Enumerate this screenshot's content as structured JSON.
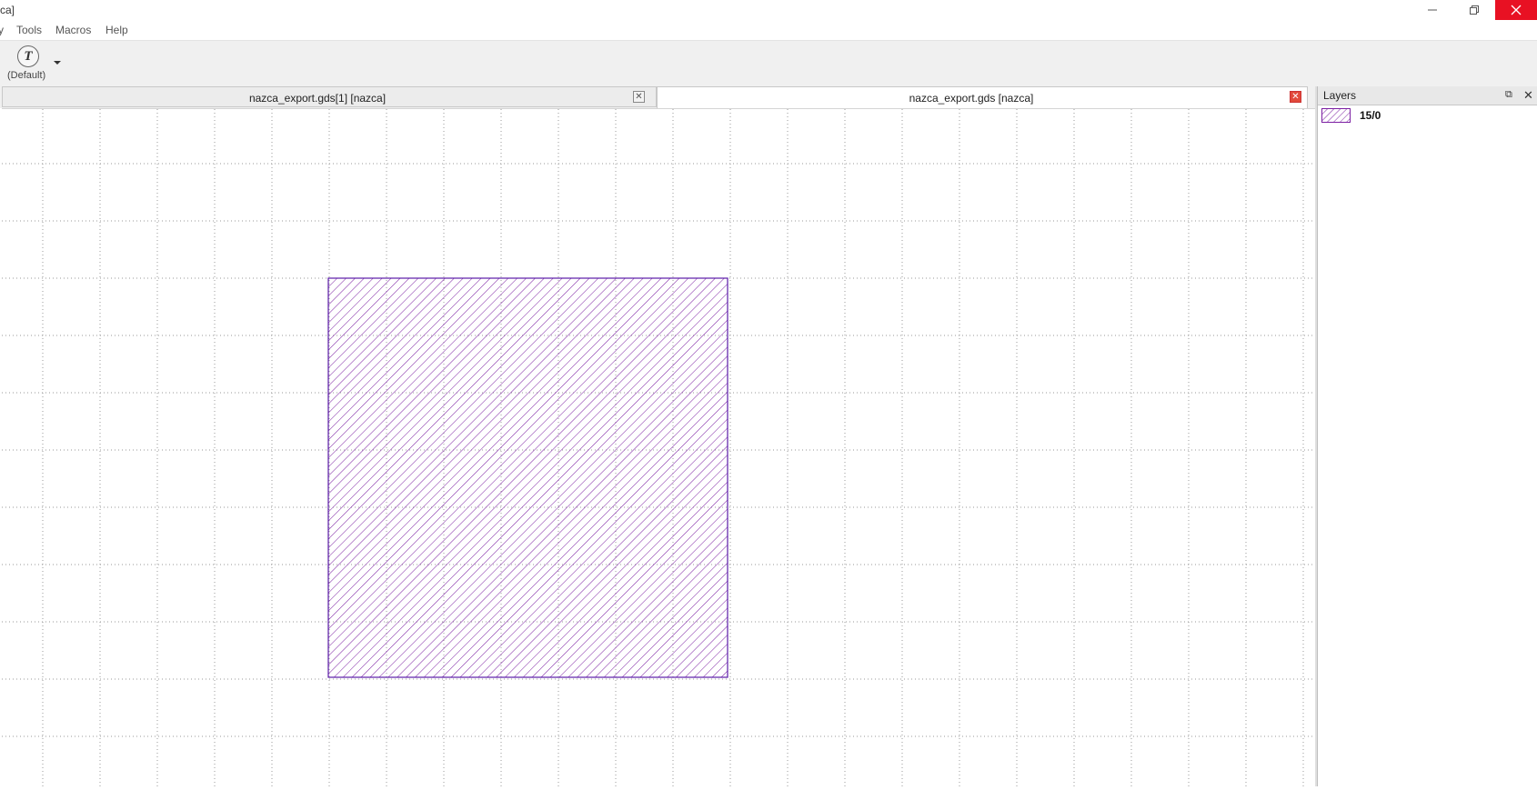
{
  "window": {
    "title_fragment": "ca]",
    "controls": {
      "minimize": "minimize",
      "restore": "restore",
      "close": "close"
    }
  },
  "menu": {
    "items": [
      {
        "label": "Tools"
      },
      {
        "label": "Macros"
      },
      {
        "label": "Help"
      }
    ]
  },
  "toolbar": {
    "tool_icon_glyph": "T",
    "tool_label": "(Default)"
  },
  "tabs": [
    {
      "label": "nazca_export.gds[1] [nazca]",
      "active": false
    },
    {
      "label": "nazca_export.gds [nazca]",
      "active": true
    }
  ],
  "layers_panel": {
    "title": "Layers",
    "layers": [
      {
        "name": "15/0",
        "color": "#7b1fa2"
      }
    ]
  },
  "canvas": {
    "background": "#ffffff",
    "grid_color": "#9a9a9a",
    "shape_color": "#7b1fa2",
    "shape_border_color": "#5a1aa8"
  }
}
